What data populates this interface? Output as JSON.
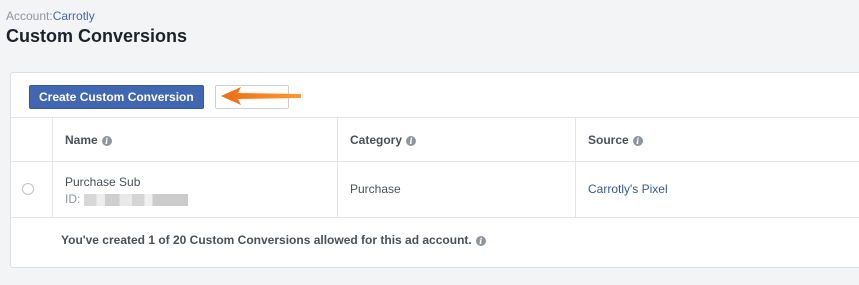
{
  "header": {
    "account_label": "Account:",
    "account_name": "Carrotly",
    "title": "Custom Conversions"
  },
  "toolbar": {
    "create_label": "Create Custom Conversion"
  },
  "table": {
    "columns": [
      {
        "label": "Name"
      },
      {
        "label": "Category"
      },
      {
        "label": "Source"
      }
    ],
    "rows": [
      {
        "name": "Purchase Sub",
        "id_label": "ID:",
        "category": "Purchase",
        "source": "Carrotly's Pixel"
      }
    ]
  },
  "footer": {
    "note": "You've created 1 of 20 Custom Conversions allowed for this ad account."
  },
  "icons": {
    "info": "info-icon",
    "annotation_arrow": "arrow-left-icon"
  },
  "colors": {
    "primary": "#4267b2",
    "link": "#365899",
    "arrow": "#f47b20"
  }
}
